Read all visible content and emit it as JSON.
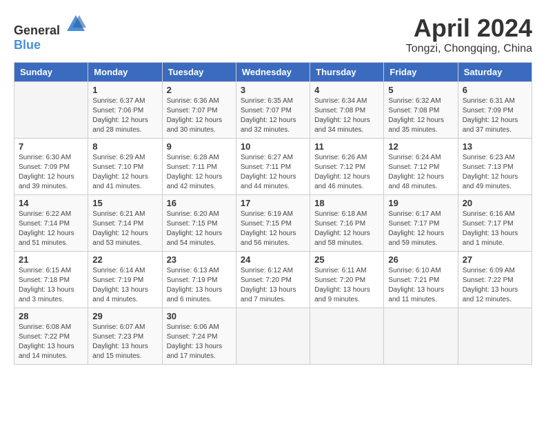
{
  "header": {
    "logo_general": "General",
    "logo_blue": "Blue",
    "month": "April 2024",
    "location": "Tongzi, Chongqing, China"
  },
  "days_of_week": [
    "Sunday",
    "Monday",
    "Tuesday",
    "Wednesday",
    "Thursday",
    "Friday",
    "Saturday"
  ],
  "weeks": [
    [
      {
        "day": "",
        "info": ""
      },
      {
        "day": "1",
        "info": "Sunrise: 6:37 AM\nSunset: 7:06 PM\nDaylight: 12 hours\nand 28 minutes."
      },
      {
        "day": "2",
        "info": "Sunrise: 6:36 AM\nSunset: 7:07 PM\nDaylight: 12 hours\nand 30 minutes."
      },
      {
        "day": "3",
        "info": "Sunrise: 6:35 AM\nSunset: 7:07 PM\nDaylight: 12 hours\nand 32 minutes."
      },
      {
        "day": "4",
        "info": "Sunrise: 6:34 AM\nSunset: 7:08 PM\nDaylight: 12 hours\nand 34 minutes."
      },
      {
        "day": "5",
        "info": "Sunrise: 6:32 AM\nSunset: 7:08 PM\nDaylight: 12 hours\nand 35 minutes."
      },
      {
        "day": "6",
        "info": "Sunrise: 6:31 AM\nSunset: 7:09 PM\nDaylight: 12 hours\nand 37 minutes."
      }
    ],
    [
      {
        "day": "7",
        "info": "Sunrise: 6:30 AM\nSunset: 7:09 PM\nDaylight: 12 hours\nand 39 minutes."
      },
      {
        "day": "8",
        "info": "Sunrise: 6:29 AM\nSunset: 7:10 PM\nDaylight: 12 hours\nand 41 minutes."
      },
      {
        "day": "9",
        "info": "Sunrise: 6:28 AM\nSunset: 7:11 PM\nDaylight: 12 hours\nand 42 minutes."
      },
      {
        "day": "10",
        "info": "Sunrise: 6:27 AM\nSunset: 7:11 PM\nDaylight: 12 hours\nand 44 minutes."
      },
      {
        "day": "11",
        "info": "Sunrise: 6:26 AM\nSunset: 7:12 PM\nDaylight: 12 hours\nand 46 minutes."
      },
      {
        "day": "12",
        "info": "Sunrise: 6:24 AM\nSunset: 7:12 PM\nDaylight: 12 hours\nand 48 minutes."
      },
      {
        "day": "13",
        "info": "Sunrise: 6:23 AM\nSunset: 7:13 PM\nDaylight: 12 hours\nand 49 minutes."
      }
    ],
    [
      {
        "day": "14",
        "info": "Sunrise: 6:22 AM\nSunset: 7:14 PM\nDaylight: 12 hours\nand 51 minutes."
      },
      {
        "day": "15",
        "info": "Sunrise: 6:21 AM\nSunset: 7:14 PM\nDaylight: 12 hours\nand 53 minutes."
      },
      {
        "day": "16",
        "info": "Sunrise: 6:20 AM\nSunset: 7:15 PM\nDaylight: 12 hours\nand 54 minutes."
      },
      {
        "day": "17",
        "info": "Sunrise: 6:19 AM\nSunset: 7:15 PM\nDaylight: 12 hours\nand 56 minutes."
      },
      {
        "day": "18",
        "info": "Sunrise: 6:18 AM\nSunset: 7:16 PM\nDaylight: 12 hours\nand 58 minutes."
      },
      {
        "day": "19",
        "info": "Sunrise: 6:17 AM\nSunset: 7:17 PM\nDaylight: 12 hours\nand 59 minutes."
      },
      {
        "day": "20",
        "info": "Sunrise: 6:16 AM\nSunset: 7:17 PM\nDaylight: 13 hours\nand 1 minute."
      }
    ],
    [
      {
        "day": "21",
        "info": "Sunrise: 6:15 AM\nSunset: 7:18 PM\nDaylight: 13 hours\nand 3 minutes."
      },
      {
        "day": "22",
        "info": "Sunrise: 6:14 AM\nSunset: 7:19 PM\nDaylight: 13 hours\nand 4 minutes."
      },
      {
        "day": "23",
        "info": "Sunrise: 6:13 AM\nSunset: 7:19 PM\nDaylight: 13 hours\nand 6 minutes."
      },
      {
        "day": "24",
        "info": "Sunrise: 6:12 AM\nSunset: 7:20 PM\nDaylight: 13 hours\nand 7 minutes."
      },
      {
        "day": "25",
        "info": "Sunrise: 6:11 AM\nSunset: 7:20 PM\nDaylight: 13 hours\nand 9 minutes."
      },
      {
        "day": "26",
        "info": "Sunrise: 6:10 AM\nSunset: 7:21 PM\nDaylight: 13 hours\nand 11 minutes."
      },
      {
        "day": "27",
        "info": "Sunrise: 6:09 AM\nSunset: 7:22 PM\nDaylight: 13 hours\nand 12 minutes."
      }
    ],
    [
      {
        "day": "28",
        "info": "Sunrise: 6:08 AM\nSunset: 7:22 PM\nDaylight: 13 hours\nand 14 minutes."
      },
      {
        "day": "29",
        "info": "Sunrise: 6:07 AM\nSunset: 7:23 PM\nDaylight: 13 hours\nand 15 minutes."
      },
      {
        "day": "30",
        "info": "Sunrise: 6:06 AM\nSunset: 7:24 PM\nDaylight: 13 hours\nand 17 minutes."
      },
      {
        "day": "",
        "info": ""
      },
      {
        "day": "",
        "info": ""
      },
      {
        "day": "",
        "info": ""
      },
      {
        "day": "",
        "info": ""
      }
    ]
  ]
}
